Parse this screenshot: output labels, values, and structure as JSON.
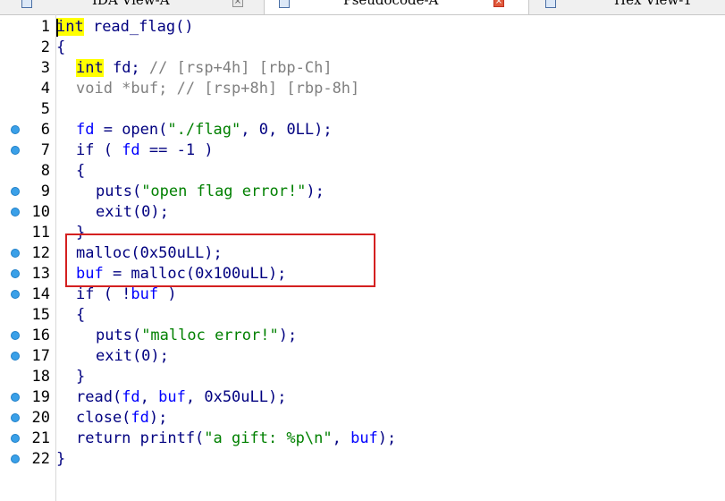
{
  "tabs": [
    {
      "label": "IDA View-A",
      "active": false,
      "close": "×"
    },
    {
      "label": "Pseudocode-A",
      "active": true,
      "close": "×"
    },
    {
      "label": "Hex View-1",
      "active": false
    }
  ],
  "breakpoint_color": "#3aa0e8",
  "highlight_color": "#d42020",
  "lines": [
    {
      "num": "1",
      "bp": false,
      "indent": 0,
      "tokens": [
        [
          "kw-hl",
          "int"
        ],
        [
          "fn",
          " read_flag()"
        ]
      ]
    },
    {
      "num": "2",
      "bp": false,
      "indent": 0,
      "tokens": [
        [
          "plain",
          "{"
        ]
      ]
    },
    {
      "num": "3",
      "bp": false,
      "indent": 1,
      "tokens": [
        [
          "kw-hl",
          "int"
        ],
        [
          "plain",
          " fd; "
        ],
        [
          "cmt",
          "// [rsp+4h] [rbp-Ch]"
        ]
      ]
    },
    {
      "num": "4",
      "bp": false,
      "indent": 1,
      "tokens": [
        [
          "cmt",
          "void *buf; // [rsp+8h] [rbp-8h]"
        ]
      ]
    },
    {
      "num": "5",
      "bp": false,
      "indent": 0,
      "tokens": []
    },
    {
      "num": "6",
      "bp": true,
      "indent": 1,
      "tokens": [
        [
          "var",
          "fd"
        ],
        [
          "plain",
          " = open("
        ],
        [
          "str",
          "\"./flag\""
        ],
        [
          "plain",
          ", 0, 0LL);"
        ]
      ]
    },
    {
      "num": "7",
      "bp": true,
      "indent": 1,
      "tokens": [
        [
          "plain",
          "if ( "
        ],
        [
          "var",
          "fd"
        ],
        [
          "plain",
          " == -1 )"
        ]
      ]
    },
    {
      "num": "8",
      "bp": false,
      "indent": 1,
      "tokens": [
        [
          "plain",
          "{"
        ]
      ]
    },
    {
      "num": "9",
      "bp": true,
      "indent": 2,
      "tokens": [
        [
          "plain",
          "puts("
        ],
        [
          "str",
          "\"open flag error!\""
        ],
        [
          "plain",
          ");"
        ]
      ]
    },
    {
      "num": "10",
      "bp": true,
      "indent": 2,
      "tokens": [
        [
          "plain",
          "exit(0);"
        ]
      ]
    },
    {
      "num": "11",
      "bp": false,
      "indent": 1,
      "tokens": [
        [
          "plain",
          "}"
        ]
      ]
    },
    {
      "num": "12",
      "bp": true,
      "indent": 1,
      "tokens": [
        [
          "plain",
          "malloc(0x50uLL);"
        ]
      ]
    },
    {
      "num": "13",
      "bp": true,
      "indent": 1,
      "tokens": [
        [
          "var",
          "buf"
        ],
        [
          "plain",
          " = malloc(0x100uLL);"
        ]
      ]
    },
    {
      "num": "14",
      "bp": true,
      "indent": 1,
      "tokens": [
        [
          "plain",
          "if ( !"
        ],
        [
          "var",
          "buf"
        ],
        [
          "plain",
          " )"
        ]
      ]
    },
    {
      "num": "15",
      "bp": false,
      "indent": 1,
      "tokens": [
        [
          "plain",
          "{"
        ]
      ]
    },
    {
      "num": "16",
      "bp": true,
      "indent": 2,
      "tokens": [
        [
          "plain",
          "puts("
        ],
        [
          "str",
          "\"malloc error!\""
        ],
        [
          "plain",
          ");"
        ]
      ]
    },
    {
      "num": "17",
      "bp": true,
      "indent": 2,
      "tokens": [
        [
          "plain",
          "exit(0);"
        ]
      ]
    },
    {
      "num": "18",
      "bp": false,
      "indent": 1,
      "tokens": [
        [
          "plain",
          "}"
        ]
      ]
    },
    {
      "num": "19",
      "bp": true,
      "indent": 1,
      "tokens": [
        [
          "plain",
          "read("
        ],
        [
          "var",
          "fd"
        ],
        [
          "plain",
          ", "
        ],
        [
          "var",
          "buf"
        ],
        [
          "plain",
          ", 0x50uLL);"
        ]
      ]
    },
    {
      "num": "20",
      "bp": true,
      "indent": 1,
      "tokens": [
        [
          "plain",
          "close("
        ],
        [
          "var",
          "fd"
        ],
        [
          "plain",
          ");"
        ]
      ]
    },
    {
      "num": "21",
      "bp": true,
      "indent": 1,
      "tokens": [
        [
          "plain",
          "return printf("
        ],
        [
          "str",
          "\"a gift: %p\\n\""
        ],
        [
          "plain",
          ", "
        ],
        [
          "var",
          "buf"
        ],
        [
          "plain",
          ");"
        ]
      ]
    },
    {
      "num": "22",
      "bp": true,
      "indent": 0,
      "tokens": [
        [
          "plain",
          "}"
        ]
      ]
    }
  ]
}
